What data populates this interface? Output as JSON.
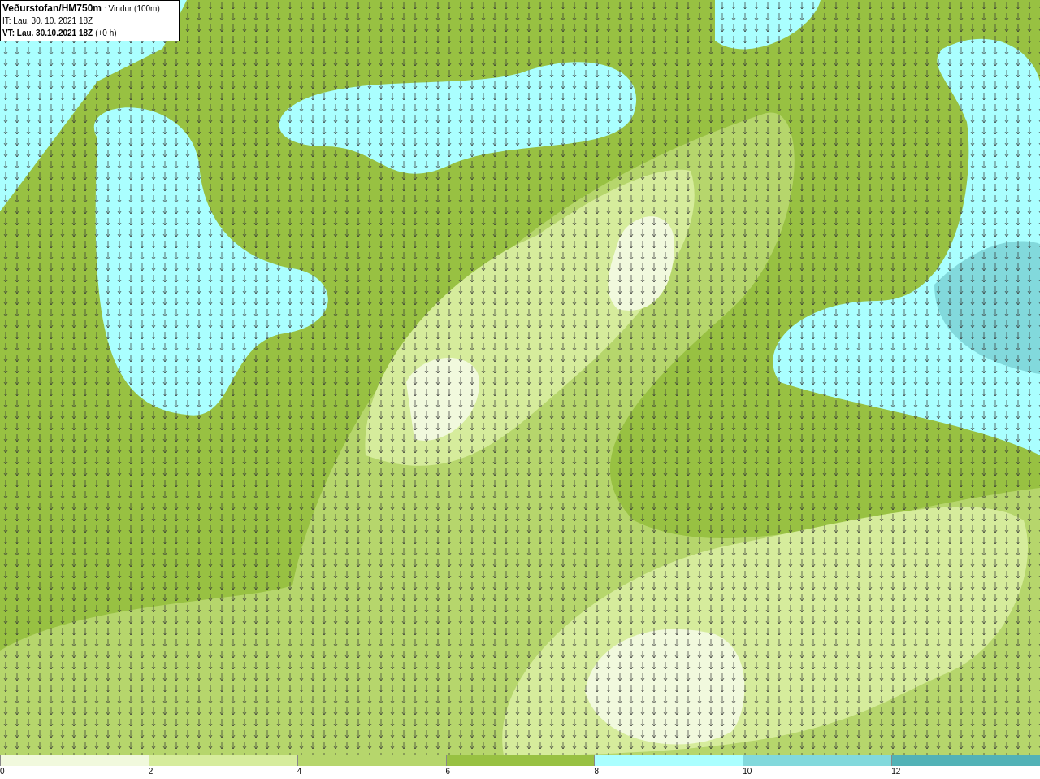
{
  "header": {
    "title": "Veðurstofan/HM750m",
    "subtitle": ": Vindur (100m)",
    "it_line": "IT: Lau. 30. 10. 2021 18Z",
    "vt_line": "VT: Lau. 30.10.2021 18Z",
    "vt_offset": "(+0 h)"
  },
  "legend": {
    "bins": [
      {
        "color": "#f1f9dd"
      },
      {
        "color": "#d6ec9c"
      },
      {
        "color": "#b6d66c"
      },
      {
        "color": "#98c142"
      },
      {
        "color": "#aaffff"
      },
      {
        "color": "#82d9dc"
      },
      {
        "color": "#52b2b6"
      }
    ],
    "labels": [
      "0",
      "2",
      "4",
      "6",
      "8",
      "10",
      "12"
    ]
  }
}
